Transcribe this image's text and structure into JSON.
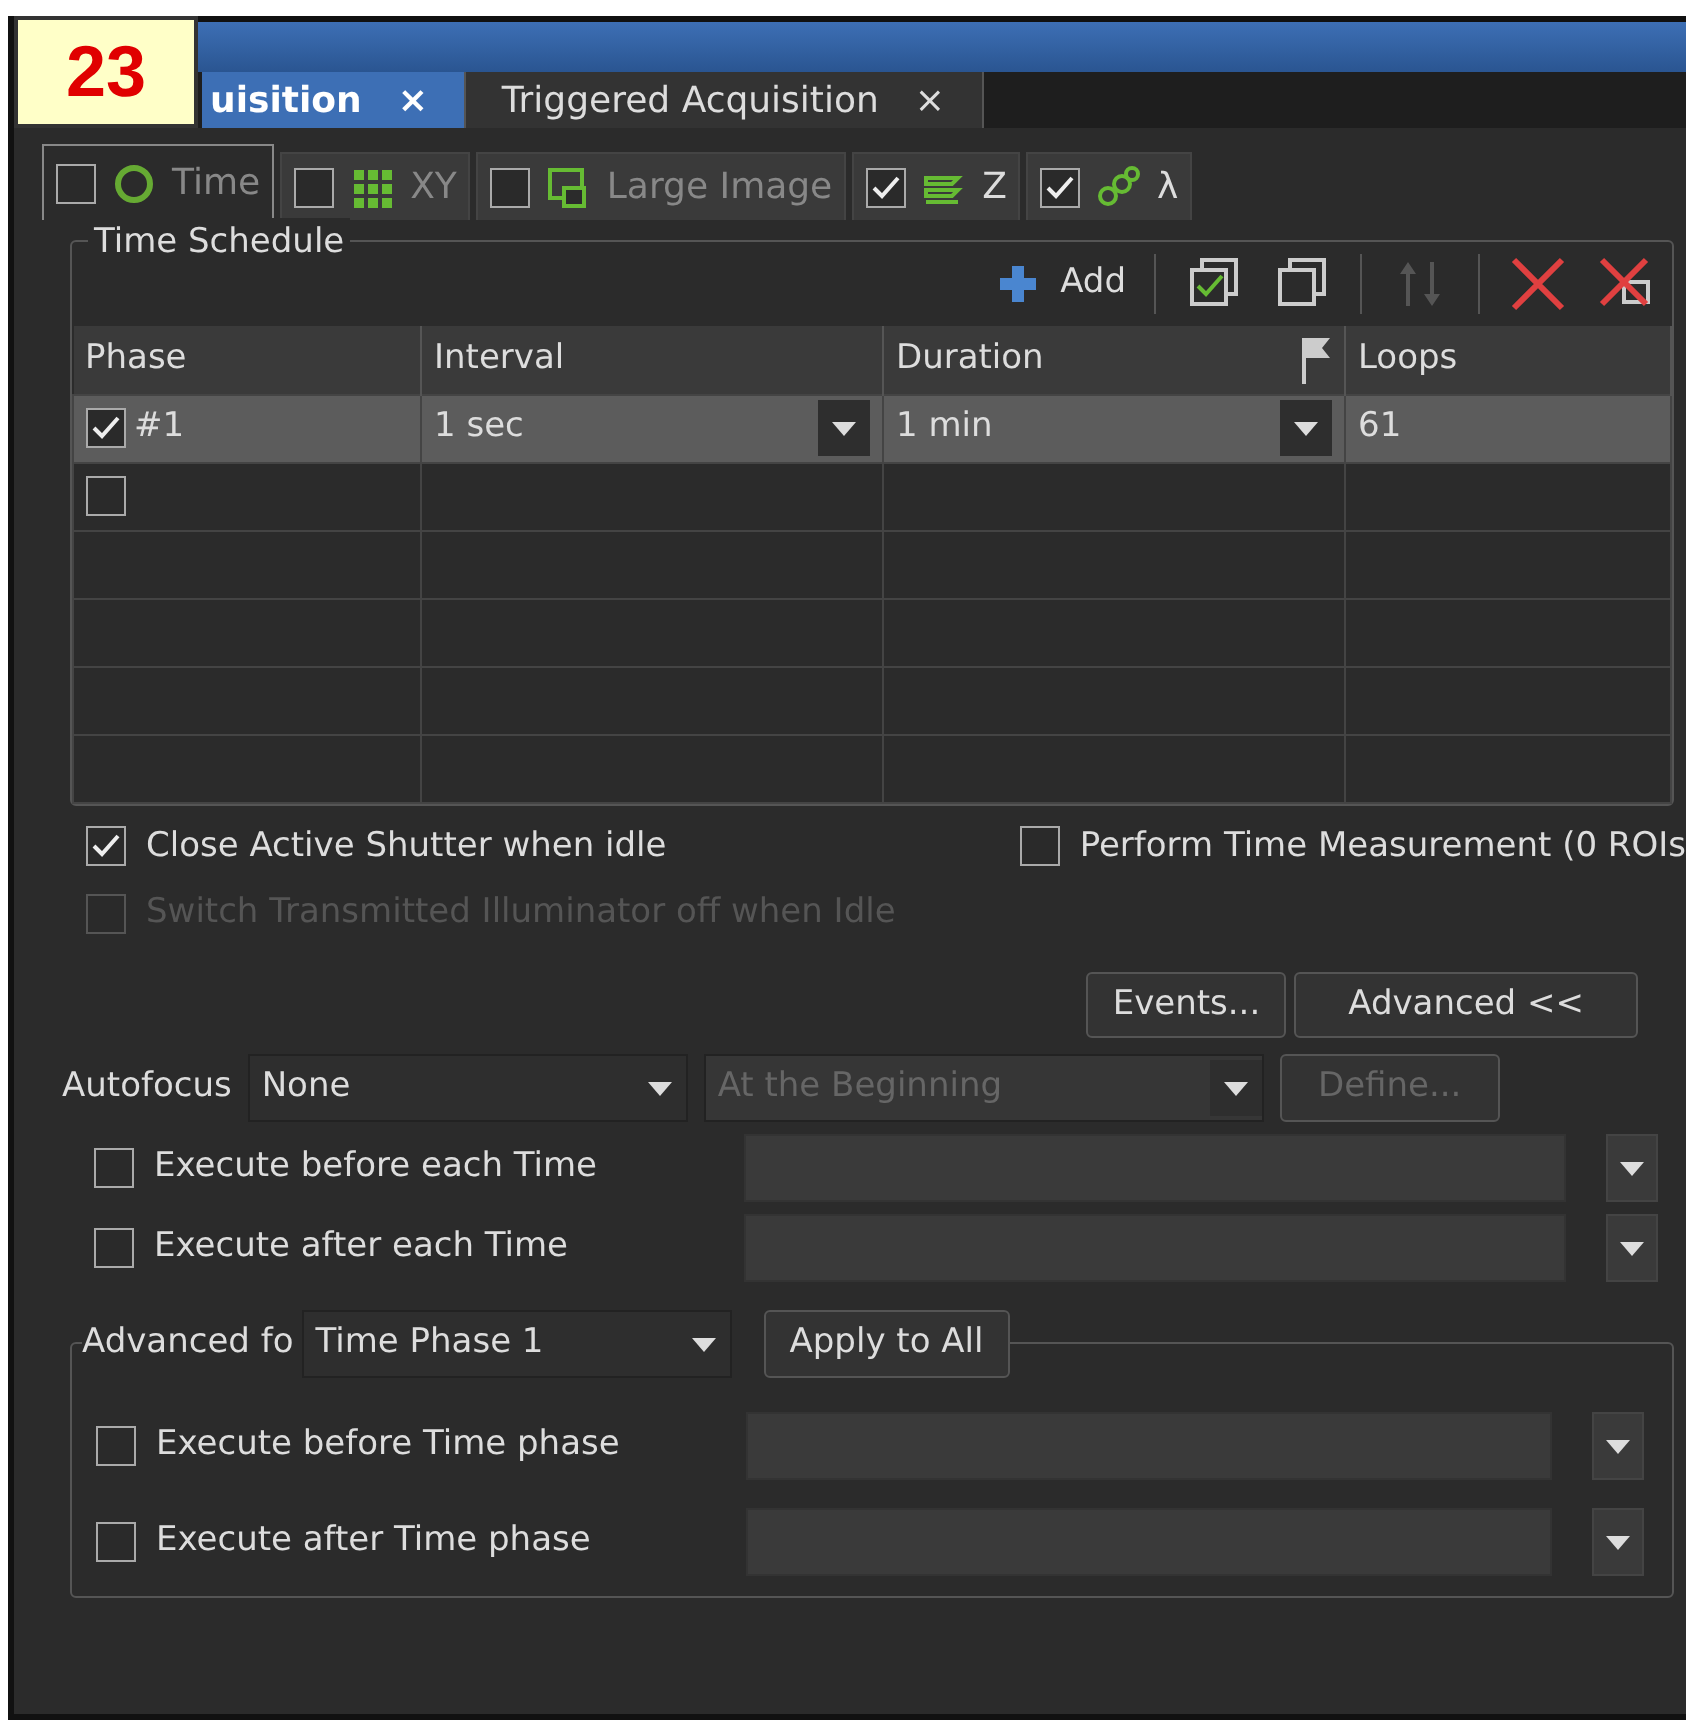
{
  "annotation": {
    "label": "23"
  },
  "doc_tabs": [
    {
      "label": "uisition",
      "selected": true,
      "close": "×"
    },
    {
      "label": "Triggered Acquisition",
      "selected": false,
      "close": "×"
    }
  ],
  "dim_tabs": [
    {
      "kind": "time",
      "label": "Time",
      "checked": false,
      "selected": true
    },
    {
      "kind": "xy",
      "label": "XY",
      "checked": false,
      "selected": false
    },
    {
      "kind": "large",
      "label": "Large Image",
      "checked": false,
      "selected": false
    },
    {
      "kind": "z",
      "label": "Z",
      "checked": true,
      "selected": false
    },
    {
      "kind": "lambda",
      "label": "λ",
      "checked": true,
      "selected": false
    }
  ],
  "time_schedule": {
    "title": "Time Schedule",
    "add": "Add",
    "columns": [
      "Phase",
      "Interval",
      "Duration",
      "Loops"
    ],
    "rows": [
      {
        "checked": true,
        "selected": true,
        "phase": "#1",
        "interval": "1 sec",
        "duration": "1 min",
        "loops": "61"
      },
      {
        "checked": false,
        "selected": false
      }
    ]
  },
  "options": [
    {
      "label": "Close Active Shutter when idle",
      "checked": true,
      "disabled": false
    },
    {
      "label": "Perform Time Measurement (0 ROIs",
      "checked": false,
      "disabled": false
    },
    {
      "label": "Switch Transmitted Illuminator off when Idle",
      "checked": false,
      "disabled": true
    }
  ],
  "buttons": [
    "Events...",
    "Advanced <<"
  ],
  "autofocus": {
    "label": "Autofocus",
    "value": "None",
    "when": "At the Beginning",
    "when_disabled": true,
    "define": "Define...",
    "define_disabled": true
  },
  "execute": [
    {
      "label": "Execute before each Time",
      "checked": false
    },
    {
      "label": "Execute after each Time",
      "checked": false
    }
  ],
  "advanced": {
    "label": "Advanced fo",
    "value": "Time Phase 1",
    "apply": "Apply to All",
    "execute": [
      {
        "label": "Execute before Time phase",
        "checked": false
      },
      {
        "label": "Execute after Time phase",
        "checked": false
      }
    ]
  }
}
